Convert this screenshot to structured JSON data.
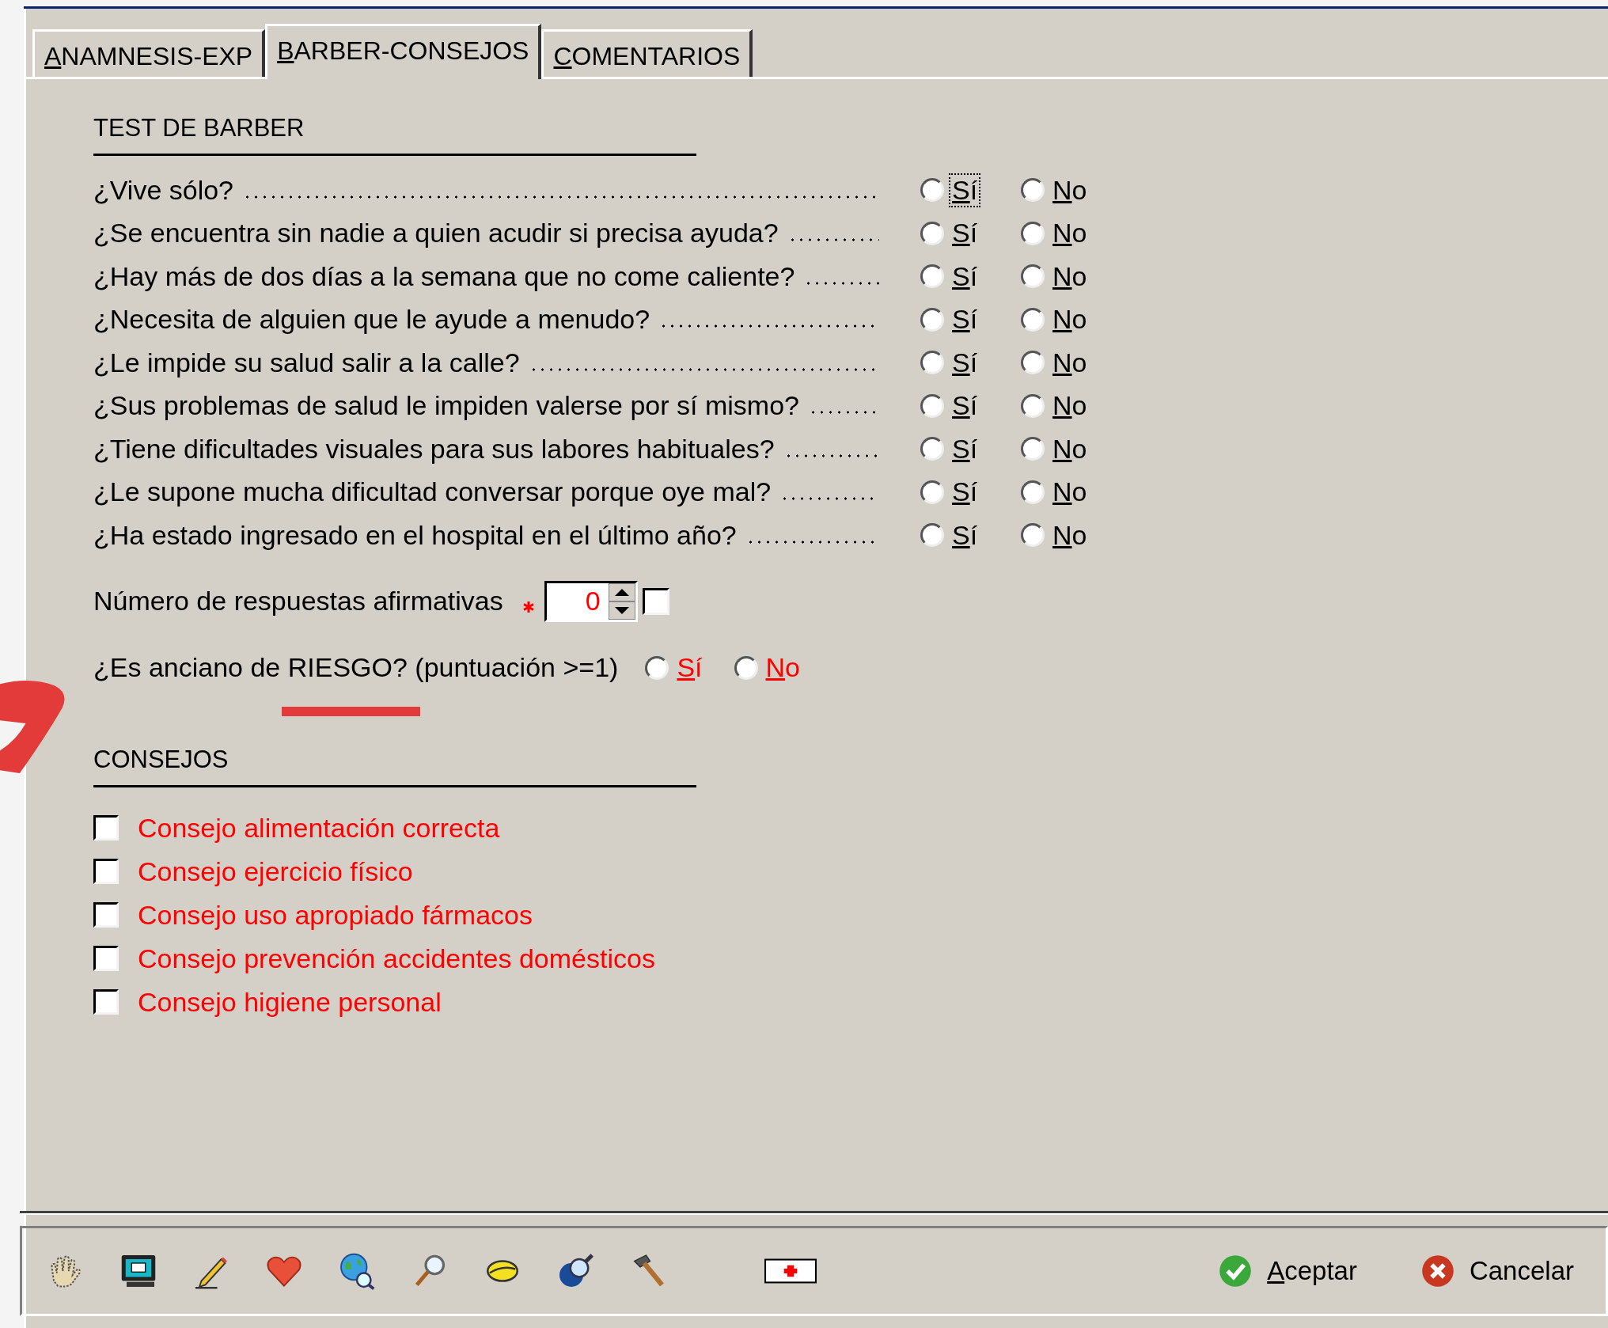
{
  "tabs": [
    {
      "label": "ANAMNESIS-EXP",
      "selected": false
    },
    {
      "label": "BARBER-CONSEJOS",
      "selected": true
    },
    {
      "label": "COMENTARIOS",
      "selected": false
    }
  ],
  "test": {
    "heading": "TEST DE BARBER",
    "questions": [
      {
        "text": "¿Vive sólo?",
        "options": [
          {
            "label": "Sí",
            "selected": false,
            "focused": true
          },
          {
            "label": "No",
            "selected": false,
            "focused": false
          }
        ]
      },
      {
        "text": "¿Se encuentra sin nadie a quien acudir si precisa ayuda?",
        "options": [
          {
            "label": "Sí",
            "selected": false,
            "focused": false
          },
          {
            "label": "No",
            "selected": false,
            "focused": false
          }
        ]
      },
      {
        "text": "¿Hay más de dos días a la semana que no come caliente?",
        "options": [
          {
            "label": "Sí",
            "selected": false,
            "focused": false
          },
          {
            "label": "No",
            "selected": false,
            "focused": false
          }
        ]
      },
      {
        "text": "¿Necesita de alguien que le ayude a menudo?",
        "options": [
          {
            "label": "Sí",
            "selected": false,
            "focused": false
          },
          {
            "label": "No",
            "selected": false,
            "focused": false
          }
        ]
      },
      {
        "text": "¿Le impide su salud salir a la calle?",
        "options": [
          {
            "label": "Sí",
            "selected": false,
            "focused": false
          },
          {
            "label": "No",
            "selected": false,
            "focused": false
          }
        ]
      },
      {
        "text": "¿Sus problemas de salud le impiden valerse por sí mismo?",
        "options": [
          {
            "label": "Sí",
            "selected": false,
            "focused": false
          },
          {
            "label": "No",
            "selected": false,
            "focused": false
          }
        ]
      },
      {
        "text": "¿Tiene dificultades visuales para sus labores habituales?",
        "options": [
          {
            "label": "Sí",
            "selected": false,
            "focused": false
          },
          {
            "label": "No",
            "selected": false,
            "focused": false
          }
        ]
      },
      {
        "text": "¿Le supone mucha dificultad conversar porque oye mal?",
        "options": [
          {
            "label": "Sí",
            "selected": false,
            "focused": false
          },
          {
            "label": "No",
            "selected": false,
            "focused": false
          }
        ]
      },
      {
        "text": "¿Ha estado ingresado en el hospital en el último año?",
        "options": [
          {
            "label": "Sí",
            "selected": false,
            "focused": false
          },
          {
            "label": "No",
            "selected": false,
            "focused": false
          }
        ]
      }
    ]
  },
  "count": {
    "label": "Número de respuestas afirmativas",
    "required": true,
    "value": "0",
    "checked": false
  },
  "risk": {
    "label": "¿Es anciano de RIESGO? (puntuación >=1)",
    "options": [
      {
        "label": "Sí",
        "selected": false
      },
      {
        "label": "No",
        "selected": false
      }
    ]
  },
  "advice": {
    "heading": "CONSEJOS",
    "items": [
      {
        "label": "Consejo alimentación correcta",
        "checked": false
      },
      {
        "label": "Consejo ejercicio físico",
        "checked": false
      },
      {
        "label": "Consejo uso apropiado fármacos",
        "checked": false
      },
      {
        "label": "Consejo prevención accidentes domésticos",
        "checked": false
      },
      {
        "label": "Consejo higiene personal",
        "checked": false
      }
    ]
  },
  "buttons": [
    {
      "label": "Aceptar",
      "kind": "ok"
    },
    {
      "label": "Cancelar",
      "kind": "cancel"
    }
  ]
}
